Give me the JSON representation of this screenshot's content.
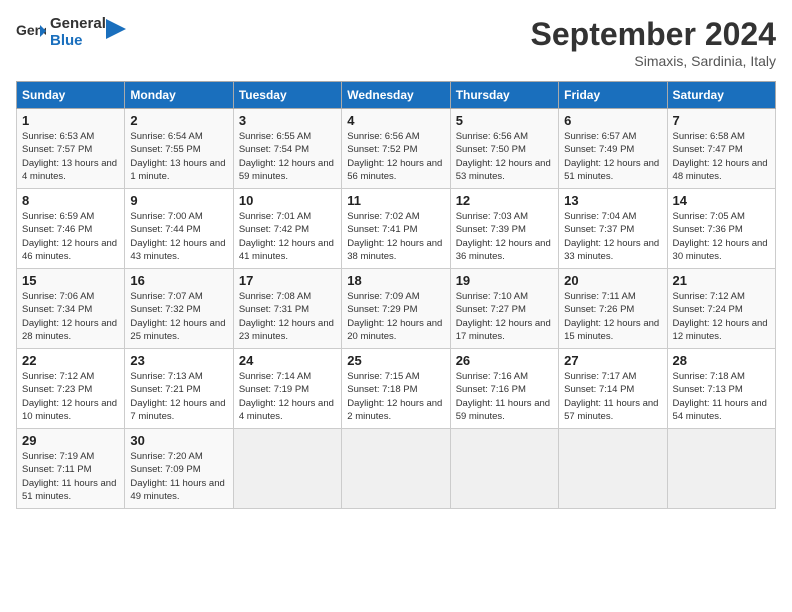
{
  "header": {
    "logo_general": "General",
    "logo_blue": "Blue",
    "month": "September 2024",
    "location": "Simaxis, Sardinia, Italy"
  },
  "days_of_week": [
    "Sunday",
    "Monday",
    "Tuesday",
    "Wednesday",
    "Thursday",
    "Friday",
    "Saturday"
  ],
  "weeks": [
    [
      {
        "day": "1",
        "rise": "6:53 AM",
        "set": "7:57 PM",
        "daylight": "13 hours and 4 minutes."
      },
      {
        "day": "2",
        "rise": "6:54 AM",
        "set": "7:55 PM",
        "daylight": "13 hours and 1 minute."
      },
      {
        "day": "3",
        "rise": "6:55 AM",
        "set": "7:54 PM",
        "daylight": "12 hours and 59 minutes."
      },
      {
        "day": "4",
        "rise": "6:56 AM",
        "set": "7:52 PM",
        "daylight": "12 hours and 56 minutes."
      },
      {
        "day": "5",
        "rise": "6:56 AM",
        "set": "7:50 PM",
        "daylight": "12 hours and 53 minutes."
      },
      {
        "day": "6",
        "rise": "6:57 AM",
        "set": "7:49 PM",
        "daylight": "12 hours and 51 minutes."
      },
      {
        "day": "7",
        "rise": "6:58 AM",
        "set": "7:47 PM",
        "daylight": "12 hours and 48 minutes."
      }
    ],
    [
      {
        "day": "8",
        "rise": "6:59 AM",
        "set": "7:46 PM",
        "daylight": "12 hours and 46 minutes."
      },
      {
        "day": "9",
        "rise": "7:00 AM",
        "set": "7:44 PM",
        "daylight": "12 hours and 43 minutes."
      },
      {
        "day": "10",
        "rise": "7:01 AM",
        "set": "7:42 PM",
        "daylight": "12 hours and 41 minutes."
      },
      {
        "day": "11",
        "rise": "7:02 AM",
        "set": "7:41 PM",
        "daylight": "12 hours and 38 minutes."
      },
      {
        "day": "12",
        "rise": "7:03 AM",
        "set": "7:39 PM",
        "daylight": "12 hours and 36 minutes."
      },
      {
        "day": "13",
        "rise": "7:04 AM",
        "set": "7:37 PM",
        "daylight": "12 hours and 33 minutes."
      },
      {
        "day": "14",
        "rise": "7:05 AM",
        "set": "7:36 PM",
        "daylight": "12 hours and 30 minutes."
      }
    ],
    [
      {
        "day": "15",
        "rise": "7:06 AM",
        "set": "7:34 PM",
        "daylight": "12 hours and 28 minutes."
      },
      {
        "day": "16",
        "rise": "7:07 AM",
        "set": "7:32 PM",
        "daylight": "12 hours and 25 minutes."
      },
      {
        "day": "17",
        "rise": "7:08 AM",
        "set": "7:31 PM",
        "daylight": "12 hours and 23 minutes."
      },
      {
        "day": "18",
        "rise": "7:09 AM",
        "set": "7:29 PM",
        "daylight": "12 hours and 20 minutes."
      },
      {
        "day": "19",
        "rise": "7:10 AM",
        "set": "7:27 PM",
        "daylight": "12 hours and 17 minutes."
      },
      {
        "day": "20",
        "rise": "7:11 AM",
        "set": "7:26 PM",
        "daylight": "12 hours and 15 minutes."
      },
      {
        "day": "21",
        "rise": "7:12 AM",
        "set": "7:24 PM",
        "daylight": "12 hours and 12 minutes."
      }
    ],
    [
      {
        "day": "22",
        "rise": "7:12 AM",
        "set": "7:23 PM",
        "daylight": "12 hours and 10 minutes."
      },
      {
        "day": "23",
        "rise": "7:13 AM",
        "set": "7:21 PM",
        "daylight": "12 hours and 7 minutes."
      },
      {
        "day": "24",
        "rise": "7:14 AM",
        "set": "7:19 PM",
        "daylight": "12 hours and 4 minutes."
      },
      {
        "day": "25",
        "rise": "7:15 AM",
        "set": "7:18 PM",
        "daylight": "12 hours and 2 minutes."
      },
      {
        "day": "26",
        "rise": "7:16 AM",
        "set": "7:16 PM",
        "daylight": "11 hours and 59 minutes."
      },
      {
        "day": "27",
        "rise": "7:17 AM",
        "set": "7:14 PM",
        "daylight": "11 hours and 57 minutes."
      },
      {
        "day": "28",
        "rise": "7:18 AM",
        "set": "7:13 PM",
        "daylight": "11 hours and 54 minutes."
      }
    ],
    [
      {
        "day": "29",
        "rise": "7:19 AM",
        "set": "7:11 PM",
        "daylight": "11 hours and 51 minutes."
      },
      {
        "day": "30",
        "rise": "7:20 AM",
        "set": "7:09 PM",
        "daylight": "11 hours and 49 minutes."
      },
      null,
      null,
      null,
      null,
      null
    ]
  ]
}
